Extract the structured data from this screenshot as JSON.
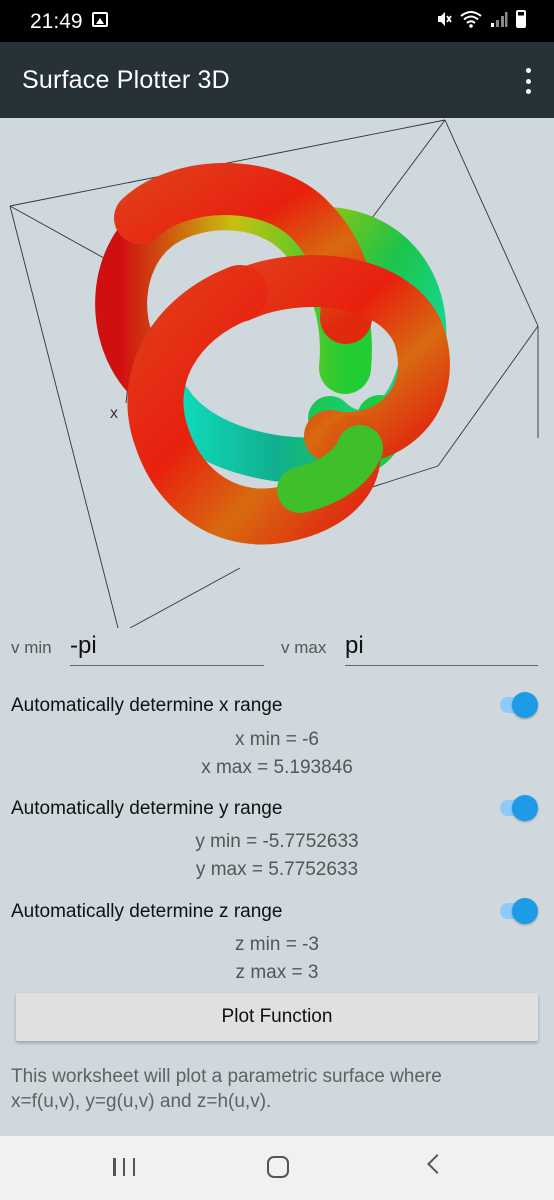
{
  "status_bar": {
    "time": "21:49"
  },
  "app_bar": {
    "title": "Surface Plotter 3D"
  },
  "plot": {
    "axis_label": "x"
  },
  "v_range": {
    "min_label": "v min",
    "min_value": "-pi",
    "max_label": "v max",
    "max_value": "pi"
  },
  "x_range": {
    "toggle_label": "Automatically determine x range",
    "enabled": true,
    "min_text": "x min = -6",
    "max_text": "x max = 5.193846"
  },
  "y_range": {
    "toggle_label": "Automatically determine y range",
    "enabled": true,
    "min_text": "y min = -5.7752633",
    "max_text": "y max = 5.7752633"
  },
  "z_range": {
    "toggle_label": "Automatically determine z range",
    "enabled": true,
    "min_text": "z min = -3",
    "max_text": "z max = 3"
  },
  "plot_button": {
    "label": "Plot Function"
  },
  "description": {
    "line1": "This worksheet will plot a parametric surface where",
    "line2": "x=f(u,v), y=g(u,v) and z=h(u,v)."
  },
  "colors": {
    "app_bar": "#263238",
    "background": "#cfd8dc",
    "switch_on": "#1e9be8"
  },
  "icons": [
    "image-icon",
    "mute-icon",
    "wifi-icon",
    "signal-icon",
    "battery-icon",
    "overflow-menu-icon",
    "recent-apps-icon",
    "home-icon",
    "back-icon"
  ]
}
